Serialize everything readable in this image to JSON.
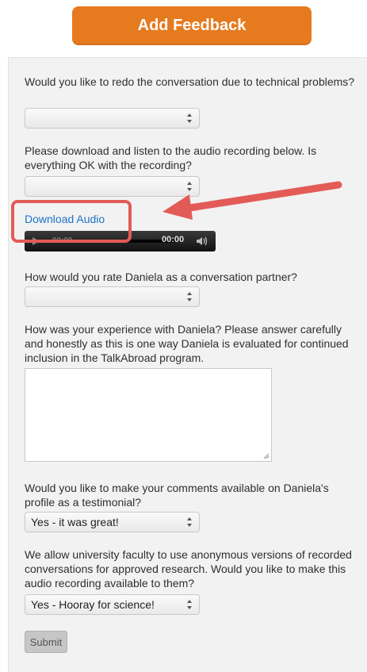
{
  "header": {
    "button_label": "Add Feedback"
  },
  "form": {
    "q1": {
      "text": "Would you like to redo the conversation due to technical problems?",
      "selected": ""
    },
    "q2": {
      "text": "Please download and listen to the audio recording below. Is everything OK with the recording?",
      "selected": ""
    },
    "download_link": "Download Audio",
    "audio_player": {
      "current_time": "00:00",
      "duration": "00:00"
    },
    "q3": {
      "text": "How would you rate Daniela as a conversation partner?",
      "selected": ""
    },
    "q4": {
      "text": "How was your experience with Daniela? Please answer carefully and honestly as this is one way Daniela is evaluated for continued inclusion in the TalkAbroad program.",
      "value": ""
    },
    "q5": {
      "text": "Would you like to make your comments available on Daniela's profile as a testimonial?",
      "selected": "Yes - it was great!"
    },
    "q6": {
      "text": "We allow university faculty to use anonymous versions of recorded conversations for approved research. Would you like to make this audio recording available to them?",
      "selected": "Yes - Hooray for science!"
    },
    "submit_label": "Submit"
  },
  "colors": {
    "accent": "#e67a1f",
    "link": "#1a73c9",
    "annotation": "#e35b57"
  }
}
